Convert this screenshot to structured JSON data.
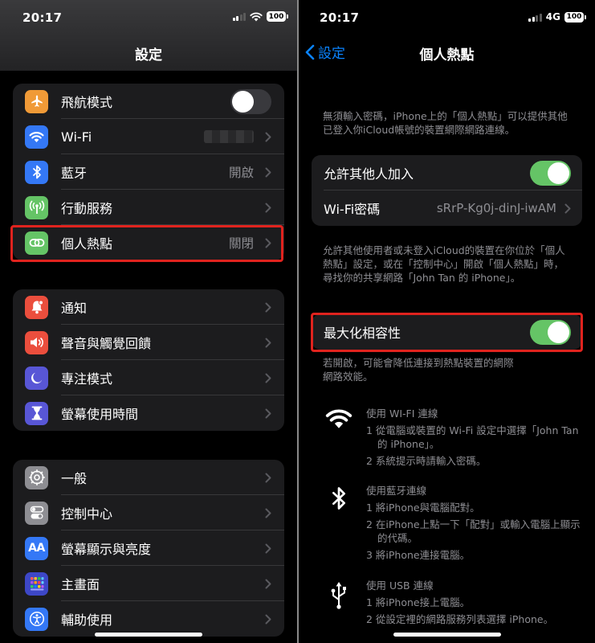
{
  "left": {
    "status": {
      "time": "20:17",
      "battery": "100"
    },
    "title": "設定",
    "groups": [
      {
        "rows": [
          {
            "label": "飛航模式",
            "icon": "airplane-icon",
            "color": "#f09a37",
            "toggle": "off"
          },
          {
            "label": "Wi-Fi",
            "icon": "wifi-icon",
            "color": "#3478f6",
            "value_blurred": true
          },
          {
            "label": "藍牙",
            "icon": "bluetooth-icon",
            "color": "#3478f6",
            "value": "開啟"
          },
          {
            "label": "行動服務",
            "icon": "antenna-icon",
            "color": "#65c466"
          },
          {
            "label": "個人熱點",
            "icon": "hotspot-link-icon",
            "color": "#65c466",
            "value": "關閉"
          }
        ]
      },
      {
        "rows": [
          {
            "label": "通知",
            "icon": "bell-icon",
            "color": "#eb4e3d"
          },
          {
            "label": "聲音與觸覺回饋",
            "icon": "speaker-icon",
            "color": "#eb4e3d"
          },
          {
            "label": "專注模式",
            "icon": "moon-icon",
            "color": "#5856d6"
          },
          {
            "label": "螢幕使用時間",
            "icon": "hourglass-icon",
            "color": "#5856d6"
          }
        ]
      },
      {
        "rows": [
          {
            "label": "一般",
            "icon": "gear-icon",
            "color": "#8e8e93"
          },
          {
            "label": "控制中心",
            "icon": "toggles-icon",
            "color": "#8e8e93"
          },
          {
            "label": "螢幕顯示與亮度",
            "icon": "aa-text-icon",
            "color": "#3478f6",
            "icon_text": "AA"
          },
          {
            "label": "主畫面",
            "icon": "home-grid-icon",
            "color": "#3478f6"
          },
          {
            "label": "輔助使用",
            "icon": "accessibility-icon",
            "color": "#3478f6"
          }
        ]
      }
    ]
  },
  "right": {
    "status": {
      "time": "20:17",
      "network": "4G",
      "battery": "100"
    },
    "back_label": "設定",
    "title": "個人熱點",
    "intro": "無須輸入密碼，iPhone上的「個人熱點」可以提供其他已登入你iCloud帳號的裝置網際網路連線。",
    "allow_others_label": "允許其他人加入",
    "allow_others_toggle": "on",
    "wifi_password_label": "Wi-Fi密碼",
    "wifi_password_value": "sRrP-Kg0j-dinJ-iwAM",
    "discover_note": "允許其他使用者或未登入iCloud的裝置在你位於「個人熱點」設定，或在「控制中心」開啟「個人熱點」時，尋找你的共享網路「John Tan 的 iPhone」。",
    "maximize_label": "最大化相容性",
    "maximize_toggle": "on",
    "maximize_note": "若開啟，可能會降低連接到熱點裝置的網際網路效能。",
    "instructions": [
      {
        "icon": "wifi-icon",
        "title": "使用 WI-FI 連線",
        "steps": [
          "1 從電腦或裝置的 Wi-Fi 設定中選擇「John Tan 的 iPhone」。",
          "2 系統提示時請輸入密碼。"
        ]
      },
      {
        "icon": "bluetooth-icon",
        "title": "使用藍牙連線",
        "steps": [
          "1 將iPhone與電腦配對。",
          "2 在iPhone上點一下「配對」或輸入電腦上顯示的代碼。",
          "3 將iPhone連接電腦。"
        ]
      },
      {
        "icon": "usb-icon",
        "title": "使用 USB 連線",
        "steps": [
          "1 將iPhone接上電腦。",
          "2 從設定裡的網路服務列表選擇 iPhone。"
        ]
      }
    ]
  },
  "colors": {
    "accent": "#0a84ff",
    "toggle_on": "#65c466",
    "highlight": "#e0231e"
  }
}
